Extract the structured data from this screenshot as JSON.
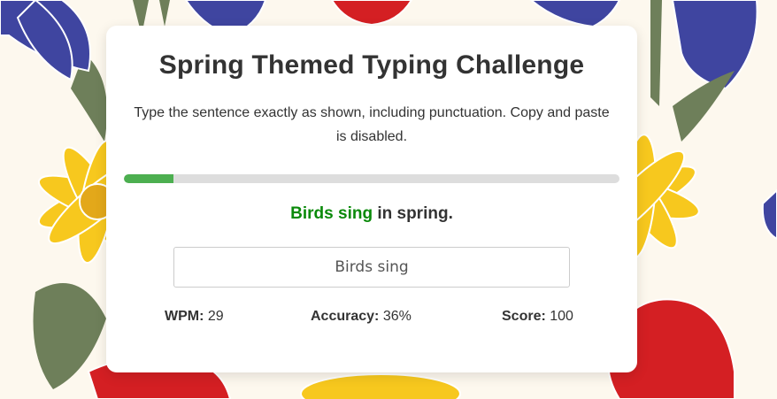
{
  "page": {
    "title": "Spring Themed Typing Challenge",
    "instructions": "Type the sentence exactly as shown, including punctuation. Copy and paste is disabled."
  },
  "progress": {
    "fraction": 0.1
  },
  "sentence": {
    "typed": "Birds sing",
    "remaining": " in spring."
  },
  "input": {
    "value": "Birds sing"
  },
  "stats": {
    "wpm_label": "WPM:",
    "wpm_value": "29",
    "accuracy_label": "Accuracy:",
    "accuracy_value": "36%",
    "score_label": "Score:",
    "score_value": "100"
  },
  "colors": {
    "progress_fill": "#4caf50",
    "typed_text": "#0a8a0a",
    "background": "#fdf8ee",
    "tulip_red": "#d41f23",
    "crocus_blue": "#3f45a0",
    "daisy_yellow": "#f7c81e",
    "leaf_green": "#6e7f5a"
  }
}
